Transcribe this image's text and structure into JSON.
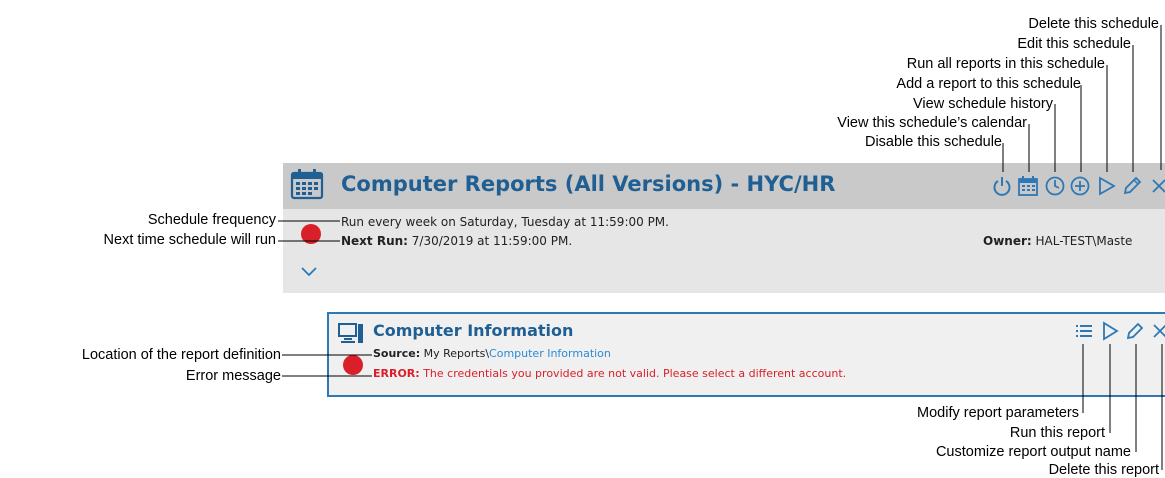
{
  "schedule": {
    "title": "Computer Reports (All Versions) - HYC/HR",
    "frequency": "Run every week on Saturday, Tuesday at 11:59:00 PM.",
    "next_run_label": "Next Run:",
    "next_run_value": "7/30/2019 at 11:59:00 PM.",
    "owner_label": "Owner:",
    "owner_value": "HAL-TEST\\Maste",
    "header_icons": [
      "power-icon",
      "calendar-icon",
      "clock-icon",
      "add-circle-icon",
      "play-icon",
      "pencil-icon",
      "close-icon"
    ],
    "status_color": "#d9202a",
    "title_color": "#1f5f93"
  },
  "report": {
    "title": "Computer Information",
    "source_label": "Source:",
    "source_path": "My Reports\\",
    "source_link": "Computer Information",
    "error_label": "ERROR:",
    "error_text": "The credentials you provided are not valid. Please select a different account.",
    "header_icons": [
      "list-icon",
      "play-icon",
      "pencil-icon",
      "close-icon"
    ],
    "border_color": "#2d78b5"
  },
  "annotations": {
    "delete_schedule": "Delete this schedule",
    "edit_schedule": "Edit this schedule",
    "run_all": "Run all reports in this schedule",
    "add_report": "Add a report to this schedule",
    "view_history": "View schedule history",
    "view_calendar": "View this schedule’s calendar",
    "disable_schedule": "Disable this schedule",
    "schedule_frequency": "Schedule frequency",
    "next_time": "Next time schedule will run",
    "location": "Location of the report definition",
    "error_message": "Error message",
    "modify_params": "Modify report parameters",
    "run_report": "Run this report",
    "customize_name": "Customize report output name",
    "delete_report": "Delete this report"
  }
}
